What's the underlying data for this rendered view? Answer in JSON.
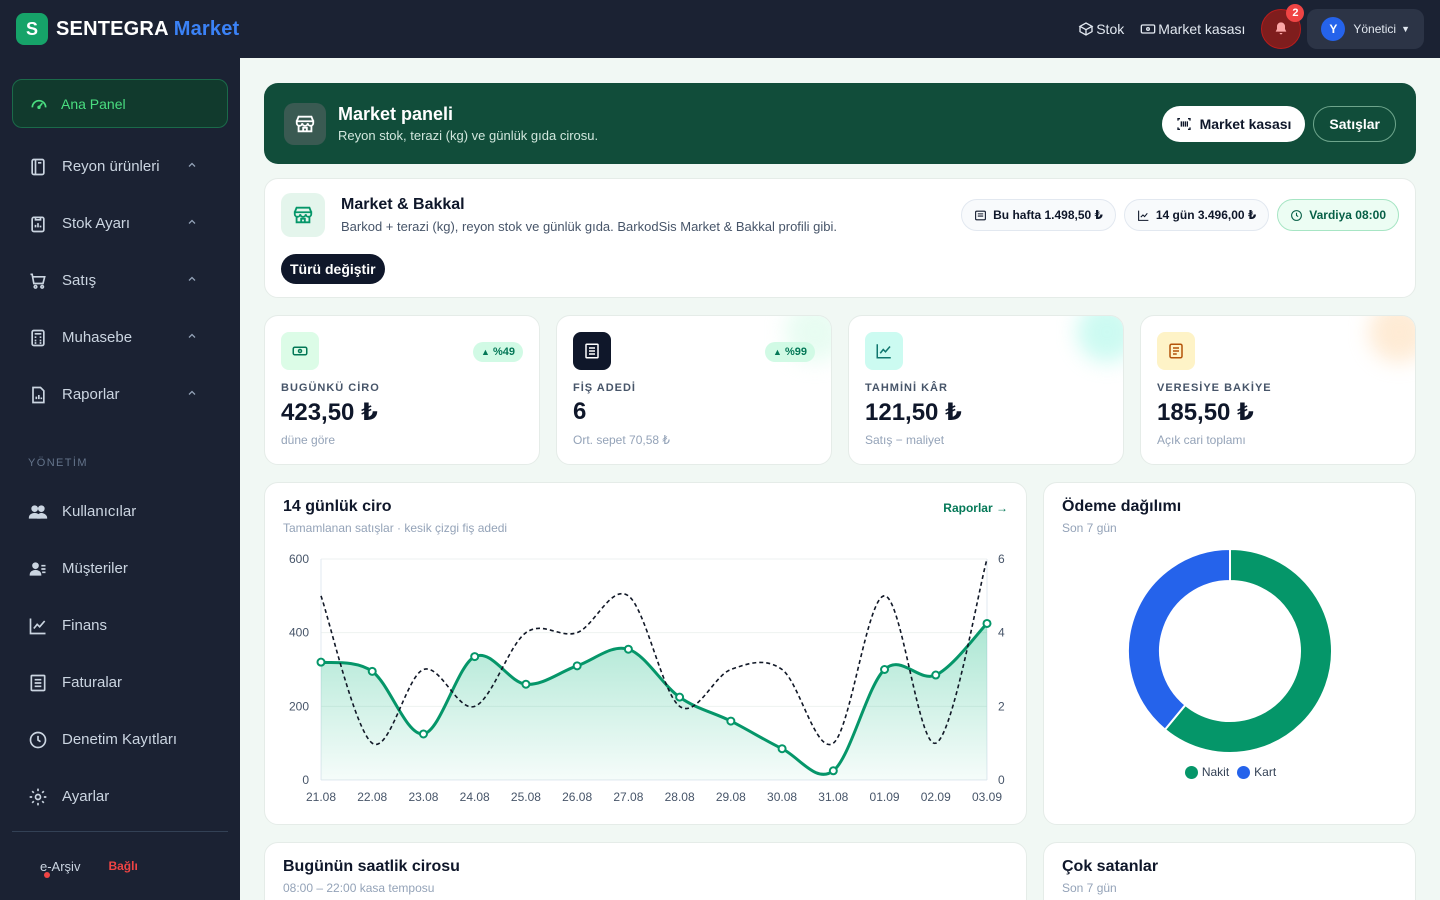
{
  "app": {
    "brand_main": "SENTEGRA",
    "brand_accent": "Market",
    "logo_letter": "S"
  },
  "topbar": {
    "stock_label": "Stok",
    "register_label": "Market kasası",
    "notification_count": "2",
    "user_initial": "Y",
    "user_name": "Yönetici"
  },
  "sidebar": {
    "active": "Ana Panel",
    "items": [
      {
        "label": "Reyon ürünleri",
        "icon": "book-icon"
      },
      {
        "label": "Stok Ayarı",
        "icon": "clipboard-icon"
      },
      {
        "label": "Satış",
        "icon": "cart-icon"
      },
      {
        "label": "Muhasebe",
        "icon": "calculator-icon"
      },
      {
        "label": "Raporlar",
        "icon": "report-icon"
      }
    ],
    "section_label": "YÖNETİM",
    "admin_items": [
      {
        "label": "Kullanıcılar",
        "icon": "users-icon"
      },
      {
        "label": "Müşteriler",
        "icon": "customers-icon"
      },
      {
        "label": "Finans",
        "icon": "chart-line-icon"
      },
      {
        "label": "Faturalar",
        "icon": "invoice-icon"
      },
      {
        "label": "Denetim Kayıtları",
        "icon": "clock-icon"
      },
      {
        "label": "Ayarlar",
        "icon": "gear-icon"
      }
    ],
    "footer_label": "e-Arşiv",
    "footer_status": "Bağlı"
  },
  "hero": {
    "title": "Market paneli",
    "subtitle": "Reyon stok, terazi (kg) ve günlük gıda cirosu.",
    "register_button": "Market kasası",
    "sales_button": "Satışlar"
  },
  "profile": {
    "title": "Market & Bakkal",
    "subtitle": "Barkod + terazi (kg), reyon stok ve günlük gıda. BarkodSis Market & Bakkal profili gibi.",
    "change_button": "Türü değiştir",
    "chip_week": "Bu hafta 1.498,50 ₺",
    "chip_14days": "14 gün 3.496,00 ₺",
    "chip_shift": "Vardiya 08:00"
  },
  "stats": [
    {
      "label": "BUGÜNKÜ CİRO",
      "value": "423,50 ₺",
      "sub": "düne göre",
      "pill": "%49",
      "icon_bg": "#dcfce7",
      "icon_color": "#047857",
      "glow": "#ffffff"
    },
    {
      "label": "FİŞ ADEDİ",
      "value": "6",
      "sub": "Ort. sepet 70,58 ₺",
      "pill": "%99",
      "icon_bg": "#0f172a",
      "icon_color": "#ffffff",
      "glow": "#d1fae5"
    },
    {
      "label": "TAHMİNİ KÂR",
      "value": "121,50 ₺",
      "sub": "Satış − maliyet",
      "pill": "",
      "icon_bg": "#ccfbf1",
      "icon_color": "#0f766e",
      "glow": "#99f6e4"
    },
    {
      "label": "VERESİYE BAKİYE",
      "value": "185,50 ₺",
      "sub": "Açık cari toplamı",
      "pill": "",
      "icon_bg": "#fef3c7",
      "icon_color": "#b45309",
      "glow": "#fed7aa"
    }
  ],
  "revenue_chart": {
    "title": "14 günlük ciro",
    "subtitle": "Tamamlanan satışlar · kesik çizgi fiş adedi",
    "link": "Raporlar"
  },
  "payment_chart": {
    "title": "Ödeme dağılımı",
    "subtitle": "Son 7 gün"
  },
  "hourly": {
    "title": "Bugünün saatlik cirosu",
    "subtitle": "08:00 – 22:00 kasa temposu"
  },
  "top_sellers": {
    "title": "Çok satanlar",
    "subtitle": "Son 7 gün"
  },
  "chart_data": [
    {
      "type": "line",
      "categories": [
        "21.08",
        "22.08",
        "23.08",
        "24.08",
        "25.08",
        "26.08",
        "27.08",
        "28.08",
        "29.08",
        "30.08",
        "31.08",
        "01.09",
        "02.09",
        "03.09"
      ],
      "series": [
        {
          "values": [
            320,
            295,
            125,
            335,
            260,
            310,
            355,
            225,
            160,
            85,
            25,
            300,
            285,
            425
          ],
          "color": "#059669",
          "style": "solid",
          "axis": "left",
          "area": true
        },
        {
          "values": [
            5,
            1,
            3,
            2,
            4,
            4,
            5,
            2,
            3,
            3,
            1,
            5,
            1,
            6
          ],
          "color": "#111827",
          "style": "dashed",
          "axis": "right"
        }
      ],
      "y_ticks_left": [
        0,
        200,
        400,
        600
      ],
      "y_ticks_right": [
        0,
        2,
        4,
        6
      ],
      "ylim_left": [
        0,
        600
      ],
      "ylim_right": [
        0,
        6
      ],
      "grid": true
    },
    {
      "type": "pie",
      "labels": [
        "Nakit",
        "Kart"
      ],
      "values": [
        61,
        39
      ],
      "colors": [
        "#059669",
        "#2563eb"
      ],
      "donut": true,
      "legend": "bottom"
    }
  ]
}
